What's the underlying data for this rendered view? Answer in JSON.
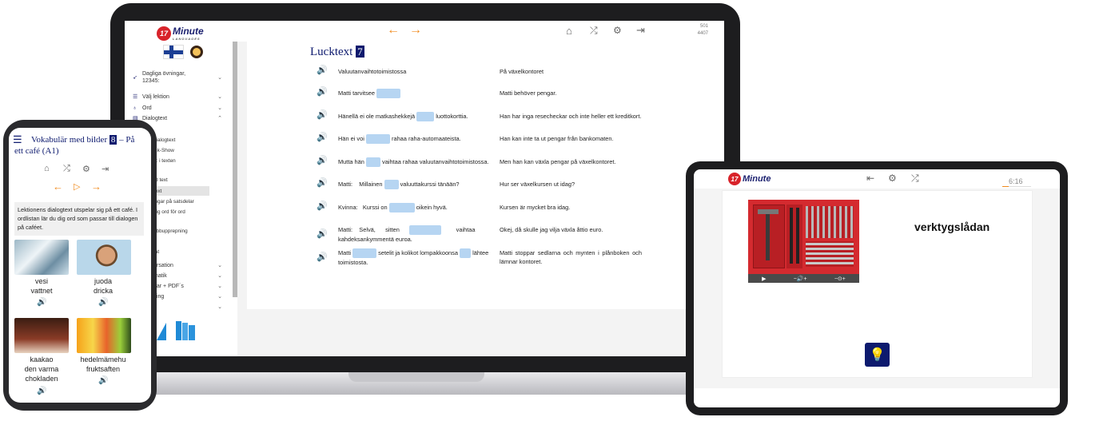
{
  "laptop": {
    "logo_number": "17",
    "logo_text": "Minute",
    "logo_sub": "LANGUAGES",
    "stats": [
      "501",
      "4407"
    ],
    "sidebar": {
      "course_label": "Dagliga övningar,",
      "course_sub": "12345:",
      "menu": [
        {
          "label": "Välj lektion"
        },
        {
          "label": "Ord"
        },
        {
          "label": "Dialogtext"
        }
      ],
      "sub_items": [
        "dialogtext",
        "ick-Show",
        "a: i texten",
        "rd text",
        "text",
        "ingar på satsdelar",
        "dig ord för ord",
        "abbupprepning",
        "t",
        "tat"
      ],
      "collapsed_items": [
        "ersation",
        "matik",
        "gar + PDF´s",
        "ning",
        ""
      ]
    },
    "title": "Lucktext",
    "title_badge": "7",
    "rows": [
      {
        "fi": [
          "Valuutanvaihtotoimistossa"
        ],
        "sv": "På växelkontoret"
      },
      {
        "fi": [
          "Matti tarvitsee",
          ""
        ],
        "sv": "Matti behöver pengar."
      },
      {
        "fi": [
          "Hänellä ei ole matkashekkejä",
          "luottokorttia."
        ],
        "sv": "Han har inga resecheckar och inte heller ett kreditkort."
      },
      {
        "fi": [
          "Hän ei voi",
          "rahaa raha-automaateista."
        ],
        "sv": "Han kan inte ta ut pengar från bankomaten."
      },
      {
        "fi": [
          "Mutta hän",
          "vaihtaa rahaa valuutanvaihtotoimistossa."
        ],
        "sv": "Men han kan växla pengar på växelkontoret."
      },
      {
        "fi": [
          "Matti:",
          "Millainen",
          "valuuttakurssi tänään?"
        ],
        "sv": "Hur ser växelkursen ut idag?"
      },
      {
        "fi": [
          "Kvinna:",
          "Kurssi on",
          "oikein hyvä."
        ],
        "sv": "Kursen är mycket bra idag."
      },
      {
        "fi": [
          "Matti:",
          "Selvä,",
          "sitten",
          "vaihtaa",
          "kahdeksankymmentä euroa."
        ],
        "sv": "Okej, då skulle jag vilja växla åttio euro."
      },
      {
        "fi": [
          "Matti",
          "setelit ja kolikot lompakkoonsa",
          "lähtee",
          "toimistosta."
        ],
        "sv": "Matti stoppar sedlarna och mynten i plånboken och lämnar kontoret."
      }
    ]
  },
  "phone": {
    "title": "Vokabulär med bilder",
    "title_badge": "8",
    "title_rest": "– På ett café (A1)",
    "description": "Lektionens dialogtext utspelar sig på ett café. I ordlistan lär du dig ord som passar till dialogen på caféet.",
    "cards": [
      {
        "fi": "vesi",
        "sv": "vattnet"
      },
      {
        "fi": "juoda",
        "sv": "dricka"
      },
      {
        "fi": "kaakao",
        "sv": "den varma chokladen"
      },
      {
        "fi": "hedelmämehu",
        "sv": "fruktsaften"
      }
    ]
  },
  "tablet": {
    "logo_number": "17",
    "logo_text": "Minute",
    "timer": "6:16",
    "word": "verktygslådan"
  },
  "colors": {
    "navy": "#0d1a6e",
    "orange": "#f08a1c",
    "gap": "#b6d5f2",
    "red": "#d8232a"
  }
}
